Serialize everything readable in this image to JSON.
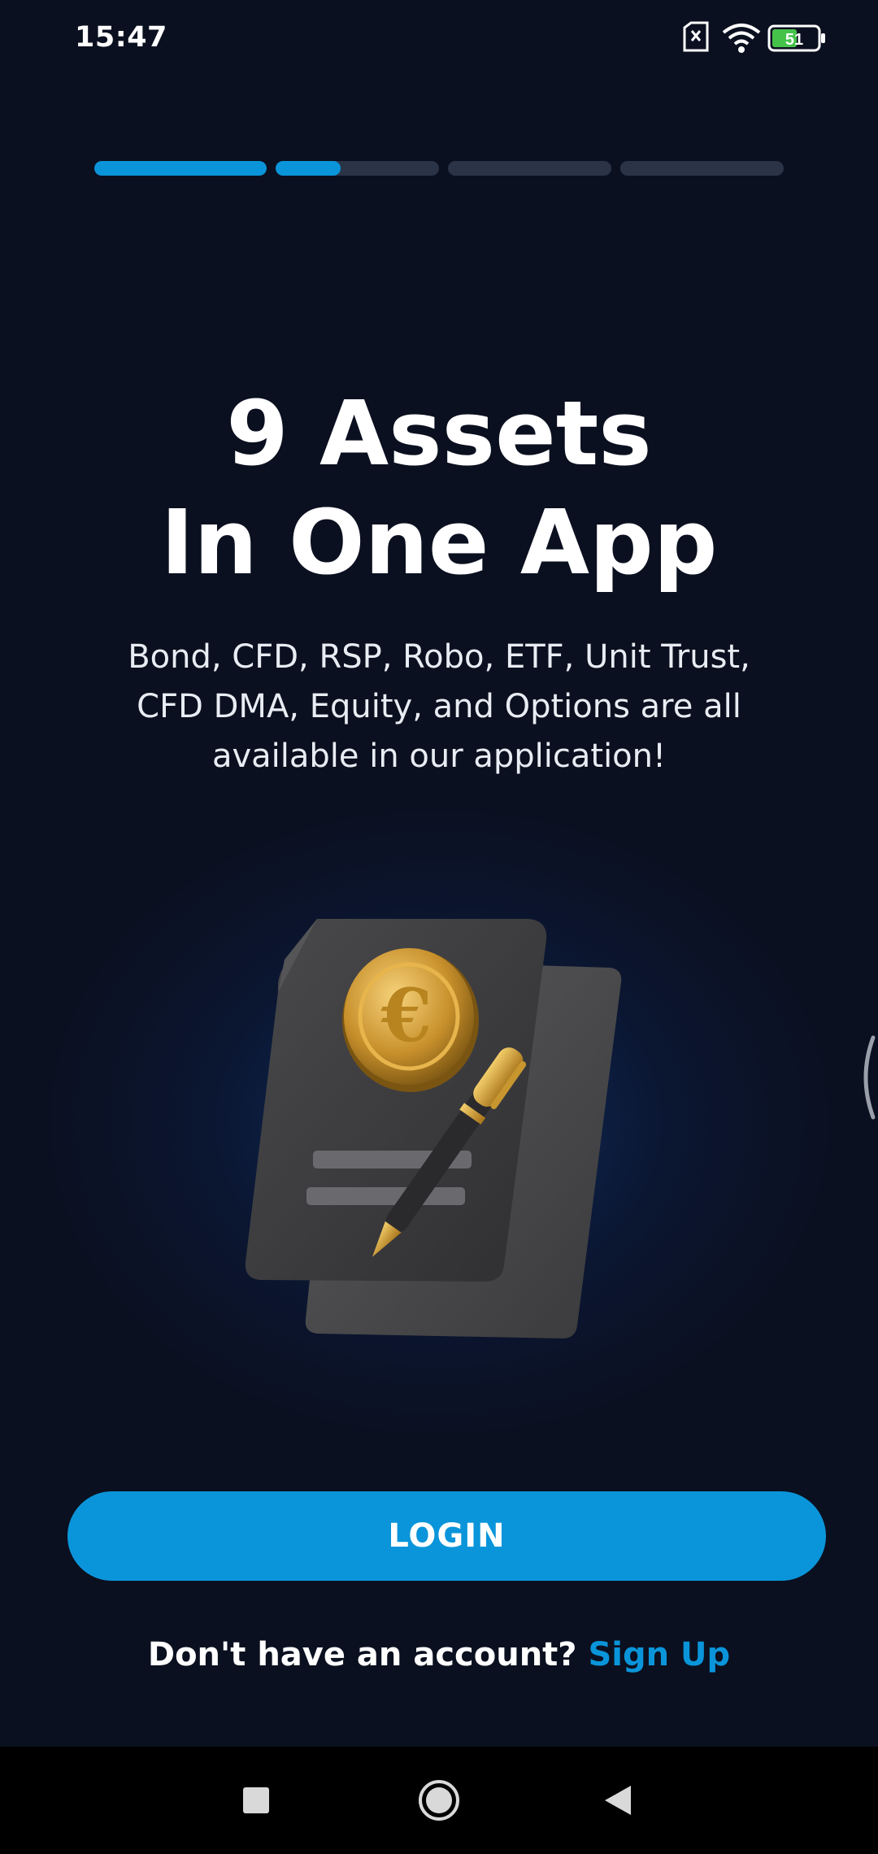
{
  "status_bar": {
    "time": "15:47",
    "battery_level": "51",
    "icons": [
      "sim-error-icon",
      "wifi-icon",
      "battery-icon"
    ]
  },
  "onboarding": {
    "progress": [
      1.0,
      0.4,
      0.0,
      0.0
    ],
    "title_line1": "9 Assets",
    "title_line2": "In One App",
    "description": "Bond, CFD, RSP, Robo, ETF, Unit Trust, CFD DMA, Equity, and Options are all available in our application!",
    "illustration": "euro-document-pen-icon"
  },
  "actions": {
    "login_label": "LOGIN",
    "signup_prompt": "Don't have an account?",
    "signup_link": "Sign Up"
  },
  "nav_bar": {
    "items": [
      "recents-icon",
      "home-icon",
      "back-icon"
    ]
  },
  "colors": {
    "background": "#0b1020",
    "accent": "#0a95da",
    "progress_track": "#2b3347"
  }
}
